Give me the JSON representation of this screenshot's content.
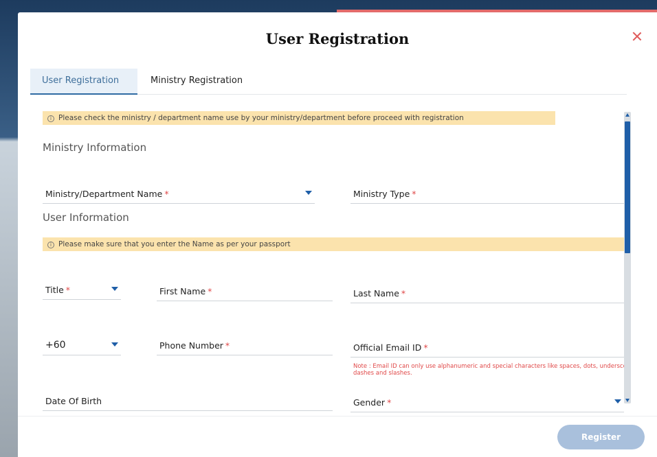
{
  "modal": {
    "title": "User Registration"
  },
  "tabs": [
    {
      "label": "User Registration",
      "active": true
    },
    {
      "label": "Ministry Registration",
      "active": false
    }
  ],
  "notices": {
    "ministry_notice": "Please check the ministry / department name use by your ministry/department before proceed with registration",
    "name_notice": "Please make sure that you enter the Name as per your passport"
  },
  "sections": {
    "ministry_info": "Ministry Information",
    "user_info": "User Information"
  },
  "fields": {
    "ministry_name": {
      "label": "Ministry/Department Name",
      "required_mark": "*"
    },
    "ministry_type": {
      "label": "Ministry Type",
      "required_mark": "*"
    },
    "title": {
      "label": "Title",
      "required_mark": "*"
    },
    "first_name": {
      "label": "First Name",
      "required_mark": "*"
    },
    "last_name": {
      "label": "Last Name",
      "required_mark": "*"
    },
    "country_code": {
      "value": "+60"
    },
    "phone_number": {
      "label": "Phone Number",
      "required_mark": "*"
    },
    "official_email": {
      "label": "Official Email ID",
      "required_mark": "*"
    },
    "date_of_birth": {
      "label": "Date Of Birth"
    },
    "gender": {
      "label": "Gender",
      "required_mark": "*"
    }
  },
  "email_note": "Note : Email ID can only use alphanumeric and special characters like spaces, dots, underscore, dashes and slashes.",
  "footer": {
    "register_label": "Register"
  },
  "colors": {
    "accent": "#1f5fa8",
    "required": "#e04848",
    "notice_bg": "#fbe3ad",
    "register_disabled": "#a9c0dc"
  }
}
